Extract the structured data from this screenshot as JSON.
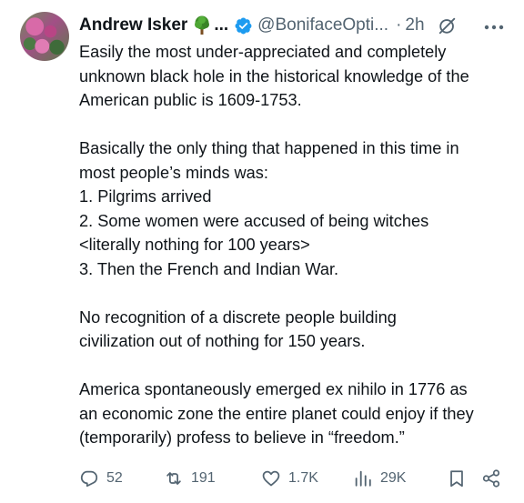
{
  "author": {
    "display_name": "Andrew Isker",
    "name_suffix": "...",
    "handle": "@BonifaceOpti...",
    "separator": "·",
    "time_ago": "2h"
  },
  "tweet": {
    "lines": [
      "Easily the most under-appreciated and completely",
      "unknown black hole in the historical knowledge of the",
      "American public is 1609-1753.",
      "",
      "Basically the only thing that happened in this time in",
      "most people’s minds was:",
      "1. Pilgrims arrived",
      "2. Some women were accused of being witches",
      "<literally nothing for 100 years>",
      "3. Then the French and Indian War.",
      "",
      "No recognition of a discrete people building",
      "civilization out of nothing for 150 years.",
      "",
      "America spontaneously emerged ex nihilo in 1776 as",
      "an economic zone the entire planet could enjoy if they",
      "(temporarily) profess to believe in “freedom.”"
    ]
  },
  "actions": {
    "replies": "52",
    "reposts": "191",
    "likes": "1.7K",
    "views": "29K"
  },
  "icons": {
    "name_emoji": "deciduous-tree",
    "verified": "verified-badge",
    "grok": "grok-icon",
    "more": "more-icon",
    "reply": "reply-icon",
    "repost": "repost-icon",
    "like": "heart-icon",
    "views": "views-icon",
    "bookmark": "bookmark-icon",
    "share": "share-icon"
  },
  "colors": {
    "text": "#0f1419",
    "secondary": "#536471",
    "verified_blue": "#1d9bf0"
  }
}
